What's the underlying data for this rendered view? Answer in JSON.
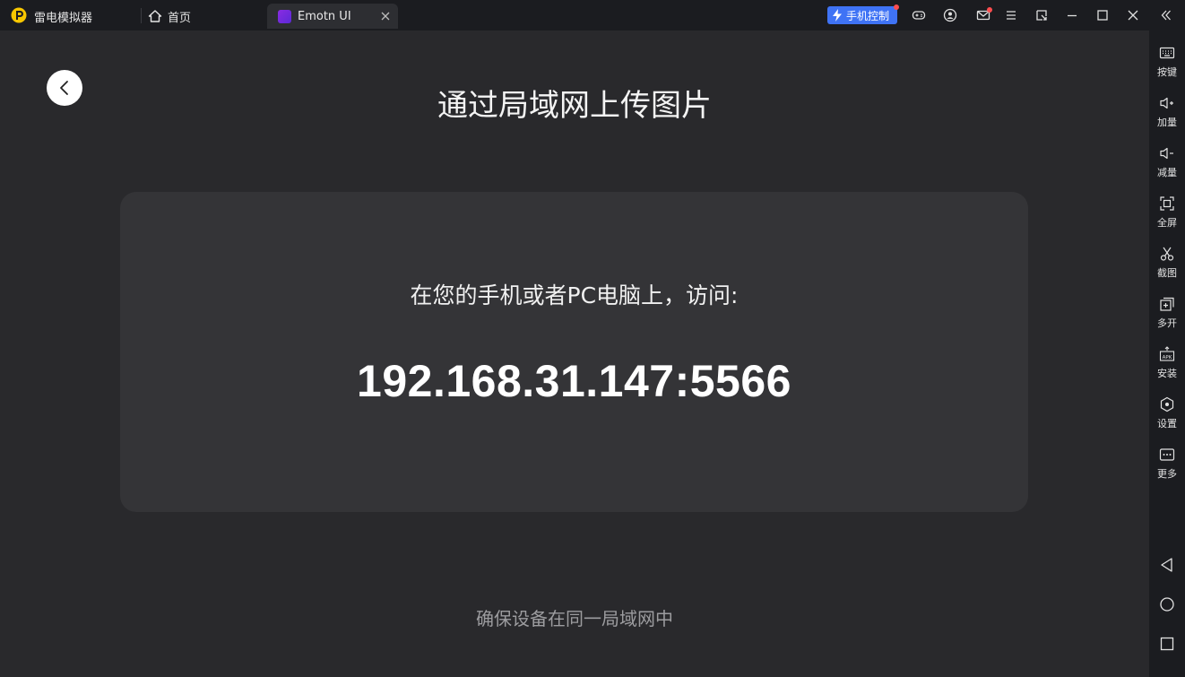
{
  "titlebar": {
    "app_name": "雷电模拟器",
    "home_tab_label": "首页",
    "active_tab_label": "Emotn UI",
    "phone_control_label": "手机控制"
  },
  "main": {
    "title": "通过局域网上传图片",
    "instruction": "在您的手机或者PC电脑上，访问:",
    "address": "192.168.31.147:5566",
    "footer_note": "确保设备在同一局域网中"
  },
  "sidebar": {
    "items": [
      {
        "label": "按键",
        "icon": "keyboard-icon"
      },
      {
        "label": "加量",
        "icon": "volume-up-icon"
      },
      {
        "label": "减量",
        "icon": "volume-down-icon"
      },
      {
        "label": "全屏",
        "icon": "fullscreen-icon"
      },
      {
        "label": "截图",
        "icon": "scissors-icon"
      },
      {
        "label": "多开",
        "icon": "multi-instance-icon"
      },
      {
        "label": "安装",
        "icon": "apk-install-icon"
      },
      {
        "label": "设置",
        "icon": "settings-icon"
      },
      {
        "label": "更多",
        "icon": "more-icon"
      }
    ]
  },
  "colors": {
    "accent": "#3f73f5",
    "notification": "#ff4d4f",
    "background": "#29292c",
    "card": "#343437"
  }
}
